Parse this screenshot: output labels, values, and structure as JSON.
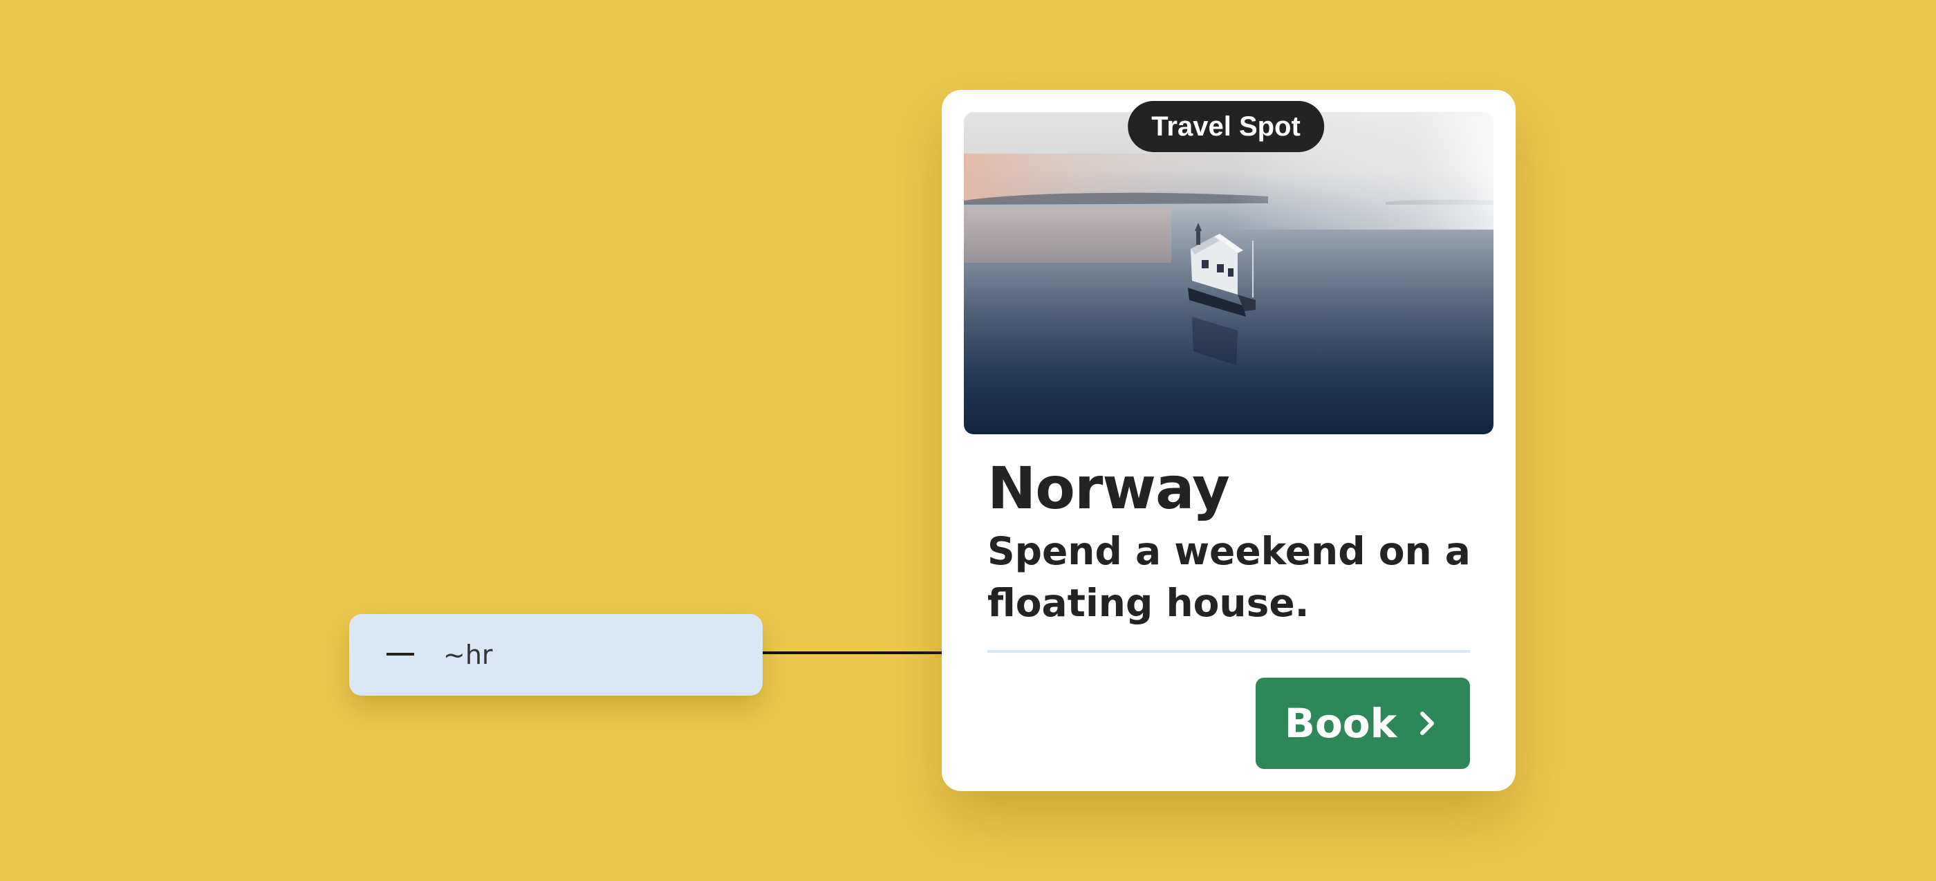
{
  "annotation": {
    "label": "~hr"
  },
  "card": {
    "badge": "Travel Spot",
    "title": "Norway",
    "subtitle": "Spend a weekend on a floating house.",
    "book_label": "Book",
    "photo_alt": "Floating house on a calm sea"
  },
  "colors": {
    "background": "#EBC84C",
    "annotation_bg": "#DAE8F5",
    "badge_bg": "#232323",
    "button_bg": "#2E8758",
    "text": "#232323"
  },
  "icons": {
    "book_icon": "chevron-right-icon",
    "annotation_icon": "dash-icon"
  }
}
